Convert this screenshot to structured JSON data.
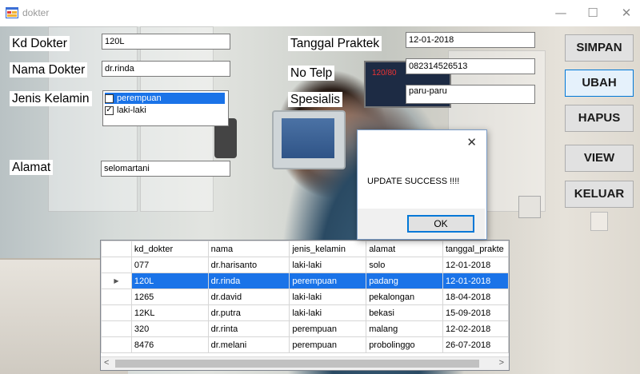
{
  "window": {
    "title": "dokter",
    "controls": {
      "minimize": "—",
      "maximize": "☐",
      "close": "✕"
    }
  },
  "form": {
    "kd_dokter": {
      "label": "Kd Dokter",
      "value": "120L"
    },
    "nama_dokter": {
      "label": "Nama Dokter",
      "value": "dr.rinda"
    },
    "jenis_kelamin": {
      "label": "Jenis Kelamin",
      "options": [
        {
          "label": "perempuan",
          "checked": false,
          "selected": true
        },
        {
          "label": "laki-laki",
          "checked": true,
          "selected": false
        }
      ]
    },
    "alamat": {
      "label": "Alamat",
      "value": "selomartani"
    },
    "tanggal_praktek": {
      "label": "Tanggal Praktek",
      "value": "12-01-2018"
    },
    "no_telp": {
      "label": "No Telp",
      "value": "082314526513"
    },
    "spesialis": {
      "label": "Spesialis",
      "value": "paru-paru"
    }
  },
  "buttons": {
    "simpan": "SIMPAN",
    "ubah": "UBAH",
    "hapus": "HAPUS",
    "view": "VIEW",
    "keluar": "KELUAR"
  },
  "background_text": {
    "monitor_reading": "120/80"
  },
  "dialog": {
    "message": "UPDATE SUCCESS !!!!",
    "ok": "OK",
    "close": "✕"
  },
  "grid": {
    "columns": [
      "kd_dokter",
      "nama",
      "jenis_kelamin",
      "alamat",
      "tanggal_prakte"
    ],
    "rows": [
      [
        "077",
        "dr.harisanto",
        "laki-laki",
        "solo",
        "12-01-2018"
      ],
      [
        "120L",
        "dr.rinda",
        "perempuan",
        "padang",
        "12-01-2018"
      ],
      [
        "1265",
        "dr.david",
        "laki-laki",
        "pekalongan",
        "18-04-2018"
      ],
      [
        "12KL",
        "dr.putra",
        "laki-laki",
        "bekasi",
        "15-09-2018"
      ],
      [
        "320",
        "dr.rinta",
        "perempuan",
        "malang",
        "12-02-2018"
      ],
      [
        "8476",
        "dr.melani",
        "perempuan",
        "probolinggo",
        "26-07-2018"
      ]
    ],
    "selected_row": 1,
    "row_pointer": "▶",
    "scroll_left": "<",
    "scroll_right": ">"
  },
  "colors": {
    "selection": "#1a73e8",
    "button_face": "#e1e1e1",
    "focus_border": "#0078d7"
  }
}
